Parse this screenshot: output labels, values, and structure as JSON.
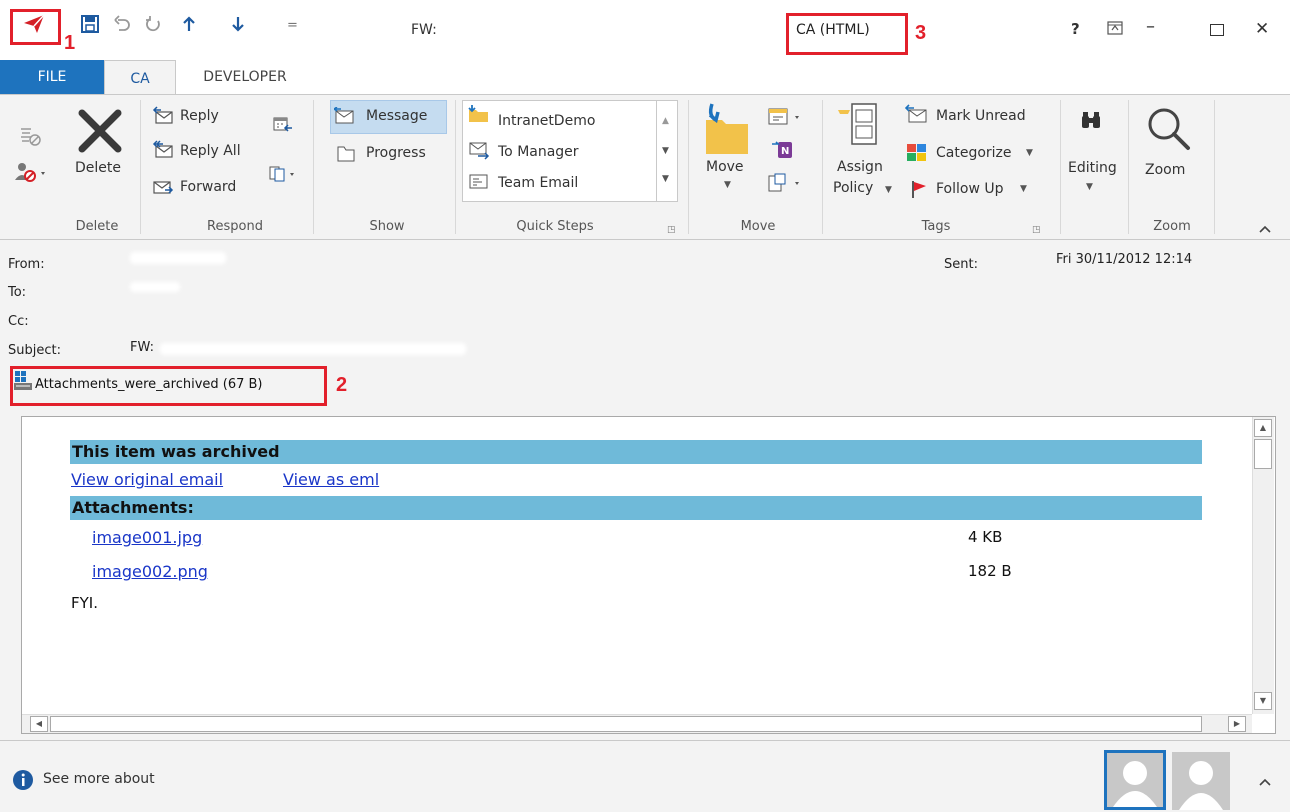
{
  "titlebar": {
    "title": "FW:",
    "window_title": "CA (HTML)",
    "help": "?",
    "minimize": "–",
    "close": "✕",
    "qat_more": "="
  },
  "annotations": {
    "one": "1",
    "two": "2",
    "three": "3"
  },
  "tabs": {
    "file": "FILE",
    "ca": "CA",
    "developer": "DEVELOPER"
  },
  "ribbon": {
    "delete": {
      "label": "Delete",
      "group": "Delete"
    },
    "respond": {
      "reply": "Reply",
      "reply_all": "Reply All",
      "forward": "Forward",
      "group": "Respond"
    },
    "show": {
      "message": "Message",
      "progress": "Progress",
      "group": "Show"
    },
    "quick_steps": {
      "items": [
        "IntranetDemo",
        "To Manager",
        "Team Email"
      ],
      "group": "Quick Steps"
    },
    "move": {
      "label": "Move",
      "group": "Move"
    },
    "tags": {
      "assign": "Assign",
      "policy": "Policy",
      "mark_unread": "Mark Unread",
      "categorize": "Categorize",
      "follow_up": "Follow Up",
      "group": "Tags"
    },
    "editing": {
      "label": "Editing"
    },
    "zoom": {
      "label": "Zoom",
      "group": "Zoom"
    }
  },
  "header": {
    "from_label": "From:",
    "to_label": "To:",
    "cc_label": "Cc:",
    "subject_label": "Subject:",
    "subject_value": "FW:",
    "sent_label": "Sent:",
    "sent_value": "Fri 30/11/2012 12:14",
    "attachment": "Attachments_were_archived (67 B)"
  },
  "body": {
    "archived_title": "This item was archived",
    "link_original": "View original email",
    "link_eml": "View as eml",
    "attachments_title": "Attachments:",
    "attachments": [
      {
        "name": "image001.jpg",
        "size": "4 KB"
      },
      {
        "name": "image002.png",
        "size": "182 B"
      }
    ],
    "text": "FYI."
  },
  "footer": {
    "see_more": "See more about"
  },
  "colors": {
    "accent": "#1e73be",
    "annotation": "#e2202b",
    "bar": "#6fbad9",
    "link": "#1a36c8"
  }
}
